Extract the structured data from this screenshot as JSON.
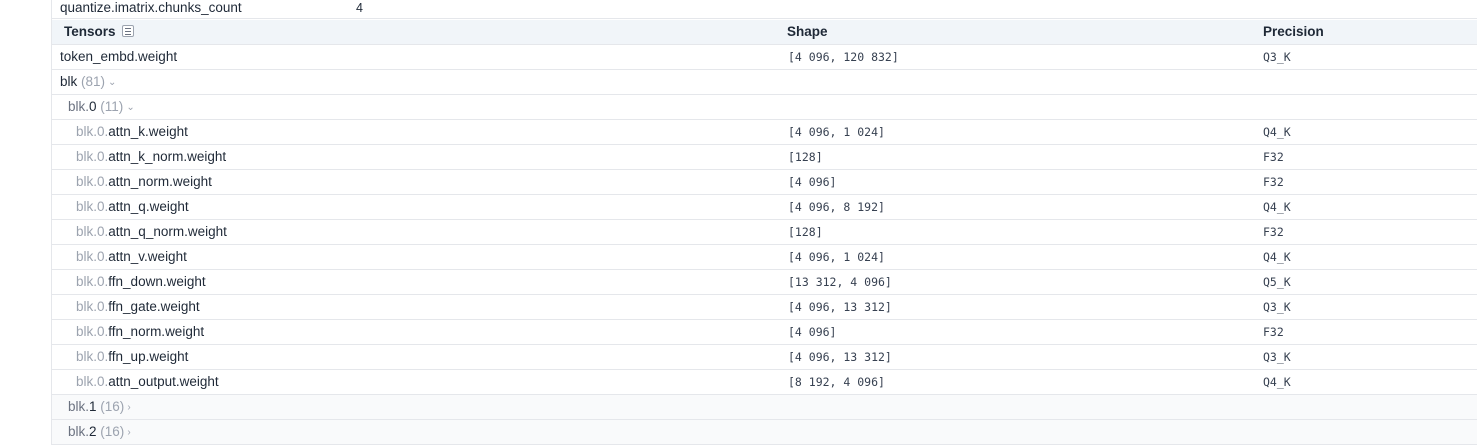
{
  "metadata_row": {
    "key": "quantize.imatrix.chunks_count",
    "value": "4"
  },
  "table": {
    "columns": {
      "tensors": "Tensors",
      "shape": "Shape",
      "precision": "Precision"
    },
    "token_embd": {
      "name": "token_embd.weight",
      "shape": "[4 096, 120 832]",
      "precision": "Q3_K"
    },
    "blk_group": {
      "label": "blk",
      "count": "(81)"
    },
    "blk0_group": {
      "prefix": "blk.",
      "index": "0",
      "count": "(11)"
    },
    "blk0_tensors": [
      {
        "prefix": "blk.0.",
        "name": "attn_k.weight",
        "shape": "[4 096, 1 024]",
        "precision": "Q4_K"
      },
      {
        "prefix": "blk.0.",
        "name": "attn_k_norm.weight",
        "shape": "[128]",
        "precision": "F32"
      },
      {
        "prefix": "blk.0.",
        "name": "attn_norm.weight",
        "shape": "[4 096]",
        "precision": "F32"
      },
      {
        "prefix": "blk.0.",
        "name": "attn_q.weight",
        "shape": "[4 096, 8 192]",
        "precision": "Q4_K"
      },
      {
        "prefix": "blk.0.",
        "name": "attn_q_norm.weight",
        "shape": "[128]",
        "precision": "F32"
      },
      {
        "prefix": "blk.0.",
        "name": "attn_v.weight",
        "shape": "[4 096, 1 024]",
        "precision": "Q4_K"
      },
      {
        "prefix": "blk.0.",
        "name": "ffn_down.weight",
        "shape": "[13 312, 4 096]",
        "precision": "Q5_K"
      },
      {
        "prefix": "blk.0.",
        "name": "ffn_gate.weight",
        "shape": "[4 096, 13 312]",
        "precision": "Q3_K"
      },
      {
        "prefix": "blk.0.",
        "name": "ffn_norm.weight",
        "shape": "[4 096]",
        "precision": "F32"
      },
      {
        "prefix": "blk.0.",
        "name": "ffn_up.weight",
        "shape": "[4 096, 13 312]",
        "precision": "Q3_K"
      },
      {
        "prefix": "blk.0.",
        "name": "attn_output.weight",
        "shape": "[8 192, 4 096]",
        "precision": "Q4_K"
      }
    ],
    "collapsed_groups": [
      {
        "prefix": "blk.",
        "index": "1",
        "count": "(16)"
      },
      {
        "prefix": "blk.",
        "index": "2",
        "count": "(16)"
      }
    ]
  },
  "colors": {
    "header_bg": "#f1f5f9",
    "border": "#e5e7eb",
    "muted_text": "#9ca3af"
  }
}
